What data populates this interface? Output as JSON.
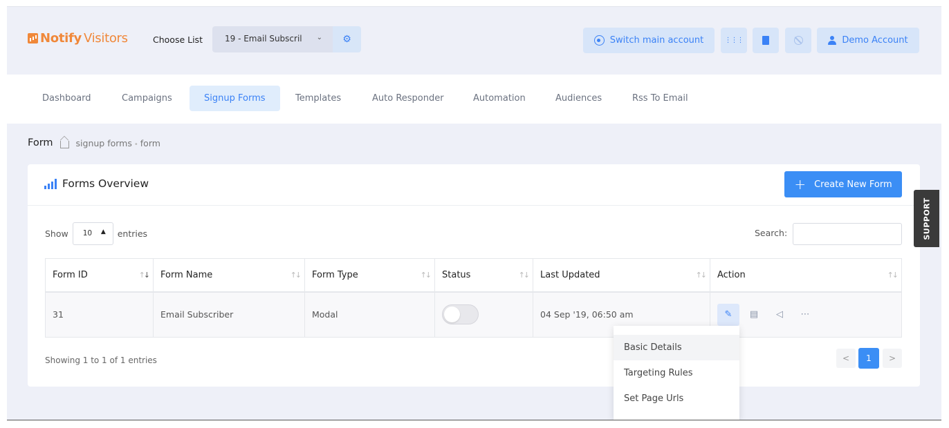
{
  "brand": {
    "name_a": "Notify",
    "name_b": "Visitors",
    "color": "#f0883a"
  },
  "header": {
    "choose_label": "Choose List",
    "list_value": "19 - Email Subscril",
    "switch_label": "Switch main account",
    "account_label": "Demo Account",
    "accent": "#3b82f6"
  },
  "nav": {
    "items": [
      "Dashboard",
      "Campaigns",
      "Signup Forms",
      "Templates",
      "Auto Responder",
      "Automation",
      "Audiences",
      "Rss To Email"
    ],
    "active": "Signup Forms"
  },
  "breadcrumb": {
    "title": "Form",
    "path_1": "signup forms",
    "path_2": "form"
  },
  "card": {
    "title": "Forms Overview",
    "create_label": "Create New Form",
    "show_label": "Show",
    "entries_per_page": "10",
    "entries_label": "entries",
    "search_label": "Search:",
    "search_value": ""
  },
  "table": {
    "columns": [
      "Form ID",
      "Form Name",
      "Form Type",
      "Status",
      "Last Updated",
      "Action"
    ],
    "rows": [
      {
        "id": "31",
        "name": "Email Subscriber",
        "type": "Modal",
        "status": "off",
        "updated": "04 Sep '19, 06:50 am"
      }
    ]
  },
  "footer": {
    "showing": "Showing 1 to 1 of 1 entries",
    "current_page": "1",
    "prev": "<",
    "next": ">"
  },
  "action_menu": {
    "items": [
      "Basic Details",
      "Targeting Rules",
      "Set Page Urls"
    ]
  },
  "support_label": "SUPPORT"
}
